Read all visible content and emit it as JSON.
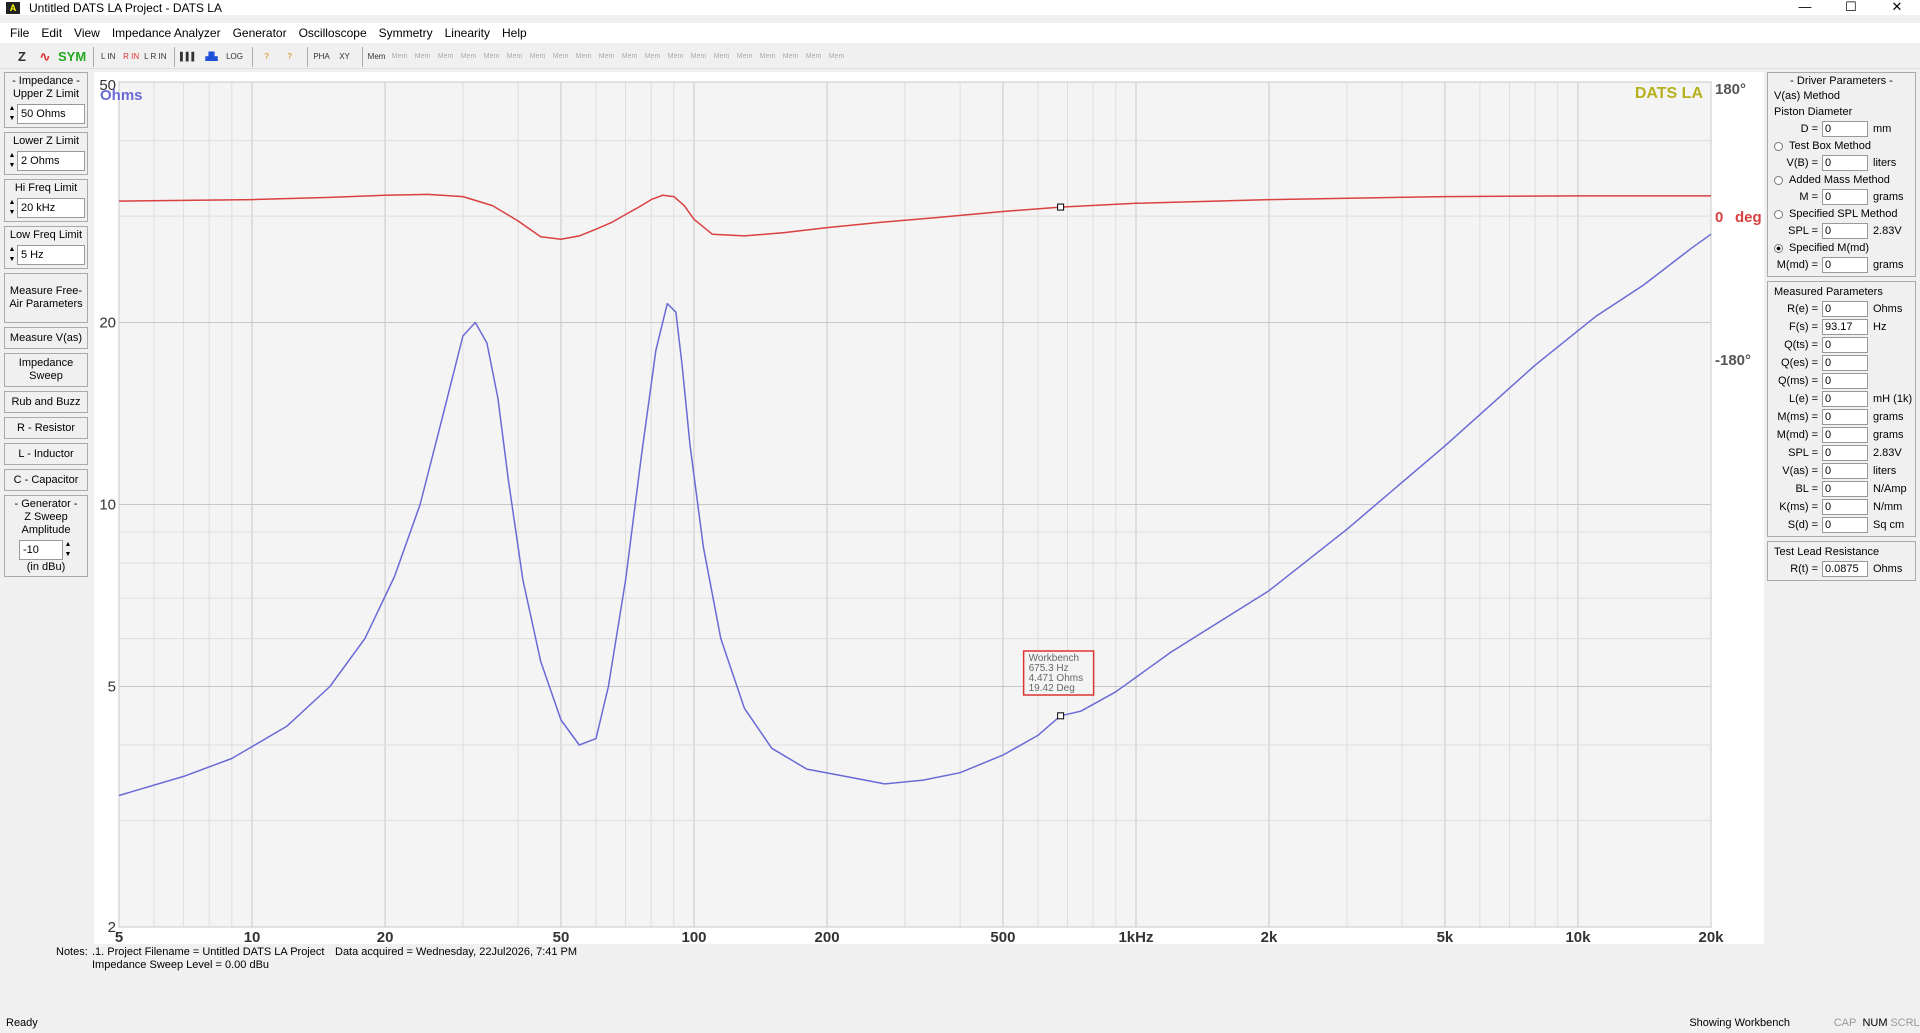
{
  "window": {
    "title": "Untitled DATS LA Project - DATS LA",
    "app_icon": "speaker-icon"
  },
  "menu": [
    "File",
    "Edit",
    "View",
    "Impedance Analyzer",
    "Generator",
    "Oscilloscope",
    "Symmetry",
    "Linearity",
    "Help"
  ],
  "toolbar": [
    {
      "name": "z-button",
      "label": "Z"
    },
    {
      "name": "phase-wave-button",
      "label": "∿"
    },
    {
      "name": "sym-button",
      "label": "SYM"
    },
    {
      "name": "l-in-button",
      "label": "L IN"
    },
    {
      "name": "r-in-button",
      "label": "R IN"
    },
    {
      "name": "lr-in-button",
      "label": "L R IN"
    },
    {
      "name": "bars-button",
      "label": "▌▌▌"
    },
    {
      "name": "spectrum-button",
      "label": "▟▙"
    },
    {
      "name": "log-button",
      "label": "LOG"
    },
    {
      "name": "help-button",
      "label": "?"
    },
    {
      "name": "context-help-button",
      "label": "?"
    },
    {
      "name": "phase-button",
      "label": "PHA"
    },
    {
      "name": "xy-button",
      "label": "XY"
    },
    {
      "name": "mem-button",
      "label": "Mem"
    },
    {
      "name": "mem-slot-1",
      "label": "Mem"
    },
    {
      "name": "mem-slot-2",
      "label": "Mem"
    },
    {
      "name": "mem-slot-3",
      "label": "Mem"
    },
    {
      "name": "mem-slot-4",
      "label": "Mem"
    },
    {
      "name": "mem-slot-5",
      "label": "Mem"
    },
    {
      "name": "mem-slot-6",
      "label": "Mem"
    },
    {
      "name": "mem-slot-7",
      "label": "Mem"
    },
    {
      "name": "mem-slot-8",
      "label": "Mem"
    },
    {
      "name": "mem-slot-9",
      "label": "Mem"
    },
    {
      "name": "mem-slot-10",
      "label": "Mem"
    },
    {
      "name": "mem-slot-11",
      "label": "Mem"
    },
    {
      "name": "mem-slot-12",
      "label": "Mem"
    },
    {
      "name": "mem-slot-13",
      "label": "Mem"
    },
    {
      "name": "mem-slot-14",
      "label": "Mem"
    },
    {
      "name": "mem-slot-15",
      "label": "Mem"
    },
    {
      "name": "mem-slot-16",
      "label": "Mem"
    },
    {
      "name": "mem-slot-17",
      "label": "Mem"
    },
    {
      "name": "mem-slot-18",
      "label": "Mem"
    },
    {
      "name": "mem-slot-19",
      "label": "Mem"
    },
    {
      "name": "mem-slot-20",
      "label": "Mem"
    }
  ],
  "left": {
    "impedance_title": "- Impedance -",
    "upper_label": "Upper Z Limit",
    "upper_value": "50 Ohms",
    "lower_label": "Lower Z Limit",
    "lower_value": "2 Ohms",
    "hi_label": "Hi Freq Limit",
    "hi_value": "20 kHz",
    "low_label": "Low Freq Limit",
    "low_value": "5 Hz",
    "btn_measure_free": "Measure Free-Air Parameters",
    "btn_measure_vas": "Measure V(as)",
    "btn_sweep": "Impedance Sweep",
    "btn_rub": "Rub and Buzz",
    "btn_resistor": "R - Resistor",
    "btn_inductor": "L - Inductor",
    "btn_capacitor": "C - Capacitor",
    "generator_title": "- Generator -",
    "z_sweep_label": "Z Sweep Amplitude",
    "amp_value": "-10",
    "amp_unit": "(in dBu)"
  },
  "plot": {
    "brand": "DATS LA",
    "ohms_label": "Ohms",
    "deg_label": "deg",
    "phase_top": "180°",
    "phase_zero": "0",
    "phase_bottom": "-180°",
    "y_ticks": [
      "50",
      "20",
      "10",
      "5",
      "2"
    ],
    "x_ticks": [
      "5",
      "10",
      "20",
      "50",
      "100",
      "200",
      "500",
      "1kHz",
      "2k",
      "5k",
      "10k",
      "20k"
    ],
    "workbench": {
      "title": "Workbench",
      "freq": "675.3 Hz",
      "ohms": "4.471 Ohms",
      "deg": "19.42 Deg"
    },
    "impedance_color": "#6a6ad6",
    "phase_color": "#d94040",
    "brand_color": "#b5b01c"
  },
  "chart_data": {
    "type": "line",
    "xlabel": "",
    "ylabel": "Ohms",
    "x_scale": "log",
    "y_scale": "log",
    "xlim": [
      5,
      20000
    ],
    "ylim": [
      2,
      50
    ],
    "y2lim": [
      -180,
      180
    ],
    "y2label": "deg",
    "grid": true,
    "series": [
      {
        "axis": "left",
        "x": [
          5,
          7,
          9,
          12,
          15,
          18,
          21,
          24,
          27,
          30,
          32,
          34,
          36,
          38,
          41,
          45,
          50,
          55,
          60,
          64,
          70,
          76,
          82,
          87,
          91,
          94,
          98,
          105,
          115,
          130,
          150,
          180,
          220,
          270,
          330,
          400,
          500,
          600,
          675,
          750,
          900,
          1200,
          2000,
          3000,
          5000,
          8000,
          11000,
          14000,
          18000,
          20000
        ],
        "y": [
          3.3,
          3.55,
          3.8,
          4.3,
          5.0,
          6.0,
          7.6,
          10.0,
          14.0,
          19.0,
          20.0,
          18.5,
          15.0,
          11.0,
          7.5,
          5.5,
          4.4,
          4.0,
          4.1,
          5.0,
          7.5,
          12.0,
          18.0,
          21.5,
          20.8,
          17.0,
          12.5,
          8.5,
          6.0,
          4.6,
          3.95,
          3.65,
          3.55,
          3.45,
          3.5,
          3.6,
          3.85,
          4.15,
          4.471,
          4.55,
          4.9,
          5.7,
          7.2,
          9.1,
          12.5,
          17.0,
          20.5,
          23.0,
          26.5,
          28.0
        ]
      },
      {
        "axis": "right",
        "x": [
          5,
          10,
          15,
          20,
          25,
          30,
          35,
          40,
          45,
          50,
          55,
          60,
          65,
          70,
          75,
          80,
          85,
          90,
          95,
          100,
          110,
          130,
          160,
          200,
          260,
          350,
          500,
          675,
          1000,
          2000,
          5000,
          10000,
          20000
        ],
        "y": [
          20,
          22,
          25,
          28,
          29,
          26,
          14,
          -6,
          -25,
          -28,
          -24,
          -16,
          -8,
          2,
          12,
          22,
          28,
          26,
          14,
          -4,
          -22,
          -24,
          -20,
          -14,
          -8,
          -2,
          6,
          12,
          17,
          22,
          26,
          27,
          27
        ]
      }
    ]
  },
  "right": {
    "driver_title": "- Driver Parameters -",
    "vas_method": "V(as) Method",
    "piston_label": "Piston Diameter",
    "d_label": "D =",
    "d_value": "0",
    "d_unit": "mm",
    "test_box": "Test Box Method",
    "vb_label": "V(B) =",
    "vb_value": "0",
    "vb_unit": "liters",
    "added_mass": "Added Mass Method",
    "m_label": "M =",
    "m_value": "0",
    "m_unit": "grams",
    "spec_spl": "Specified SPL Method",
    "spl_label": "SPL =",
    "spl_value": "0",
    "spl_unit": "2.83V",
    "spec_mmd": "Specified M(md)",
    "mmd_label": "M(md) =",
    "mmd_value": "0",
    "mmd_unit": "grams",
    "measured_title": "Measured Parameters",
    "measured": [
      {
        "label": "R(e) =",
        "value": "0",
        "unit": "Ohms"
      },
      {
        "label": "F(s) =",
        "value": "93.17",
        "unit": "Hz"
      },
      {
        "label": "Q(ts) =",
        "value": "0",
        "unit": ""
      },
      {
        "label": "Q(es) =",
        "value": "0",
        "unit": ""
      },
      {
        "label": "Q(ms) =",
        "value": "0",
        "unit": ""
      },
      {
        "label": "L(e) =",
        "value": "0",
        "unit": "mH (1k)"
      },
      {
        "label": "M(ms) =",
        "value": "0",
        "unit": "grams"
      },
      {
        "label": "M(md) =",
        "value": "0",
        "unit": "grams"
      },
      {
        "label": "SPL =",
        "value": "0",
        "unit": "2.83V"
      },
      {
        "label": "V(as) =",
        "value": "0",
        "unit": "liters"
      },
      {
        "label": "BL =",
        "value": "0",
        "unit": "N/Amp"
      },
      {
        "label": "K(ms) =",
        "value": "0",
        "unit": "N/mm"
      },
      {
        "label": "S(d) =",
        "value": "0",
        "unit": "Sq cm"
      }
    ],
    "lead_title": "Test Lead Resistance",
    "rt_label": "R(t) =",
    "rt_value": "0.0875",
    "rt_unit": "Ohms"
  },
  "notes": {
    "label": "Notes:",
    "line1": ".1. Project Filename = Untitled DATS LA Project",
    "acquired": "Data acquired = Wednesday, 22Jul2026, 7:41 PM",
    "line2": "Impedance Sweep Level =  0.00 dBu"
  },
  "status": {
    "ready": "Ready",
    "mode": "Showing Workbench",
    "cap": "CAP",
    "num": "NUM",
    "scrl": "SCRL"
  }
}
